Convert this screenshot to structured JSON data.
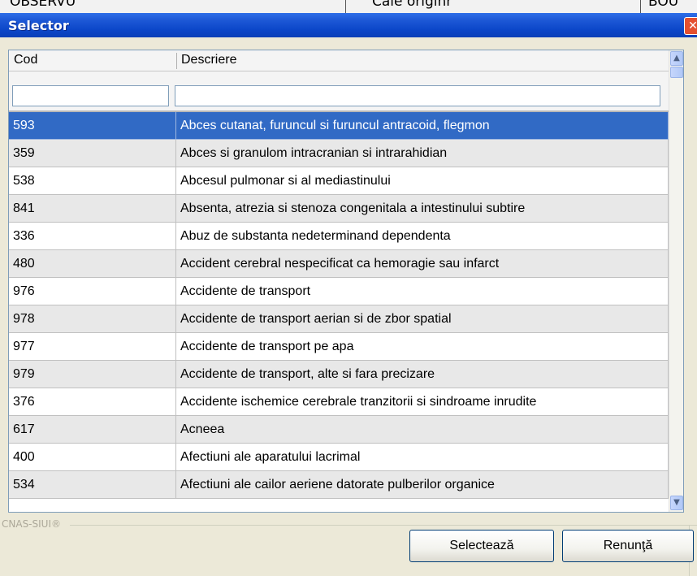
{
  "background": {
    "cells": [
      "OBSERVU",
      "Cale originr",
      "BOU"
    ]
  },
  "window": {
    "title": "Selector",
    "close_glyph": "✕"
  },
  "grid": {
    "columns": [
      "Cod",
      "Descriere"
    ],
    "rows": [
      {
        "cod": "593",
        "descriere": "Abces cutanat, furuncul si furuncul antracoid, flegmon"
      },
      {
        "cod": "359",
        "descriere": "Abces si granulom intracranian si intrarahidian"
      },
      {
        "cod": "538",
        "descriere": "Abcesul pulmonar si al mediastinului"
      },
      {
        "cod": "841",
        "descriere": "Absenta, atrezia si stenoza congenitala a intestinului subtire"
      },
      {
        "cod": "336",
        "descriere": "Abuz de substanta nedeterminand dependenta"
      },
      {
        "cod": "480",
        "descriere": "Accident cerebral nespecificat ca hemoragie sau infarct"
      },
      {
        "cod": "976",
        "descriere": "Accidente de transport"
      },
      {
        "cod": "978",
        "descriere": "Accidente de transport aerian si de zbor spatial"
      },
      {
        "cod": "977",
        "descriere": "Accidente de transport pe apa"
      },
      {
        "cod": "979",
        "descriere": "Accidente de transport, alte si fara precizare"
      },
      {
        "cod": "376",
        "descriere": "Accidente ischemice cerebrale tranzitorii si sindroame inrudite"
      },
      {
        "cod": "617",
        "descriere": "Acneea"
      },
      {
        "cod": "400",
        "descriere": "Afectiuni ale aparatului lacrimal"
      },
      {
        "cod": "534",
        "descriere": "Afectiuni ale cailor aeriene datorate pulberilor organice"
      }
    ],
    "selected_index": 0
  },
  "footer": {
    "label": "CNAS-SIUI®",
    "select_button": "Selectează",
    "cancel_button": "Renunţă"
  },
  "colors": {
    "title_bar": "#0b46c8",
    "selection": "#316ac5"
  }
}
